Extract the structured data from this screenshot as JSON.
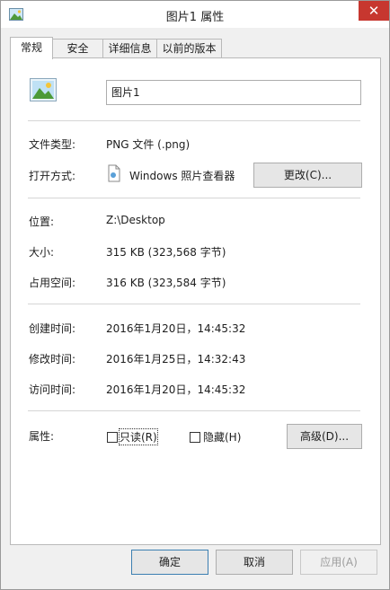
{
  "window": {
    "title": "图片1 属性",
    "close_glyph": "✕"
  },
  "tabs": [
    {
      "label": "常规"
    },
    {
      "label": "安全"
    },
    {
      "label": "详细信息"
    },
    {
      "label": "以前的版本"
    }
  ],
  "general": {
    "file_name": "图片1",
    "file_type_label": "文件类型:",
    "file_type_value": "PNG 文件 (.png)",
    "opens_with_label": "打开方式:",
    "opens_with_value": "Windows 照片查看器",
    "change_button": "更改(C)...",
    "location_label": "位置:",
    "location_value": "Z:\\Desktop",
    "size_label": "大小:",
    "size_value": "315 KB (323,568 字节)",
    "size_on_disk_label": "占用空间:",
    "size_on_disk_value": "316 KB (323,584 字节)",
    "created_label": "创建时间:",
    "created_value": "2016年1月20日，14:45:32",
    "modified_label": "修改时间:",
    "modified_value": "2016年1月25日，14:32:43",
    "accessed_label": "访问时间:",
    "accessed_value": "2016年1月20日，14:45:32",
    "attributes_label": "属性:",
    "readonly_label": "只读(R)",
    "readonly_checked": false,
    "hidden_label": "隐藏(H)",
    "hidden_checked": false,
    "advanced_button": "高级(D)..."
  },
  "footer": {
    "ok_button": "确定",
    "cancel_button": "取消",
    "apply_button": "应用(A)"
  },
  "colors": {
    "close_bg": "#c7372f",
    "primary_border": "#3c7fb1"
  }
}
